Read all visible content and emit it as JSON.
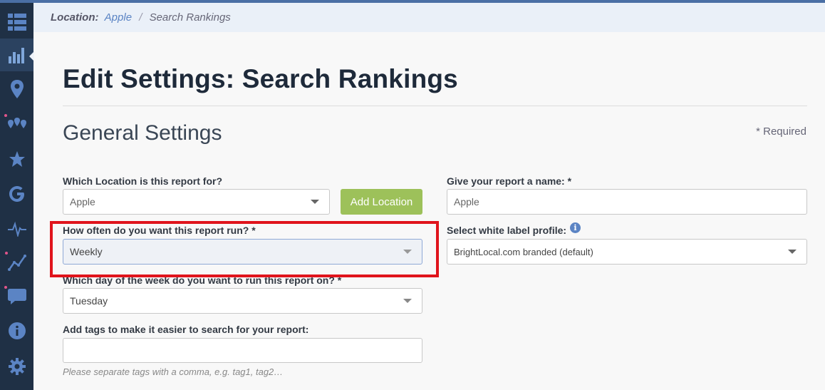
{
  "sidebar": {
    "items": [
      {
        "icon": "grid-icon"
      },
      {
        "icon": "bar-chart-icon",
        "active": true
      },
      {
        "icon": "map-pin-icon"
      },
      {
        "icon": "multi-pin-icon"
      },
      {
        "icon": "star-icon"
      },
      {
        "icon": "google-icon"
      },
      {
        "icon": "pulse-icon"
      },
      {
        "icon": "trend-icon"
      },
      {
        "icon": "chat-icon"
      },
      {
        "icon": "info-icon"
      },
      {
        "icon": "gear-icon"
      }
    ]
  },
  "breadcrumb": {
    "prefix": "Location:",
    "location": "Apple",
    "separator": "/",
    "current": "Search Rankings"
  },
  "page": {
    "title": "Edit Settings: Search Rankings",
    "section": "General Settings",
    "required_note": "* Required"
  },
  "form": {
    "location": {
      "label": "Which Location is this report for?",
      "value": "Apple"
    },
    "add_location_button": "Add Location",
    "report_name": {
      "label": "Give your report a name: *",
      "value": "Apple"
    },
    "frequency": {
      "label": "How often do you want this report run? *",
      "value": "Weekly"
    },
    "white_label": {
      "label": "Select white label profile:",
      "value": "BrightLocal.com branded (default)"
    },
    "day_of_week": {
      "label": "Which day of the week do you want to run this report on? *",
      "value": "Tuesday"
    },
    "tags": {
      "label": "Add tags to make it easier to search for your report:",
      "value": "",
      "hint": "Please separate tags with a comma, e.g. tag1, tag2…"
    }
  },
  "colors": {
    "sidebar": "#1f3045",
    "accent": "#5b84c4",
    "add_button": "#9dc15a",
    "highlight": "#e0141c"
  }
}
